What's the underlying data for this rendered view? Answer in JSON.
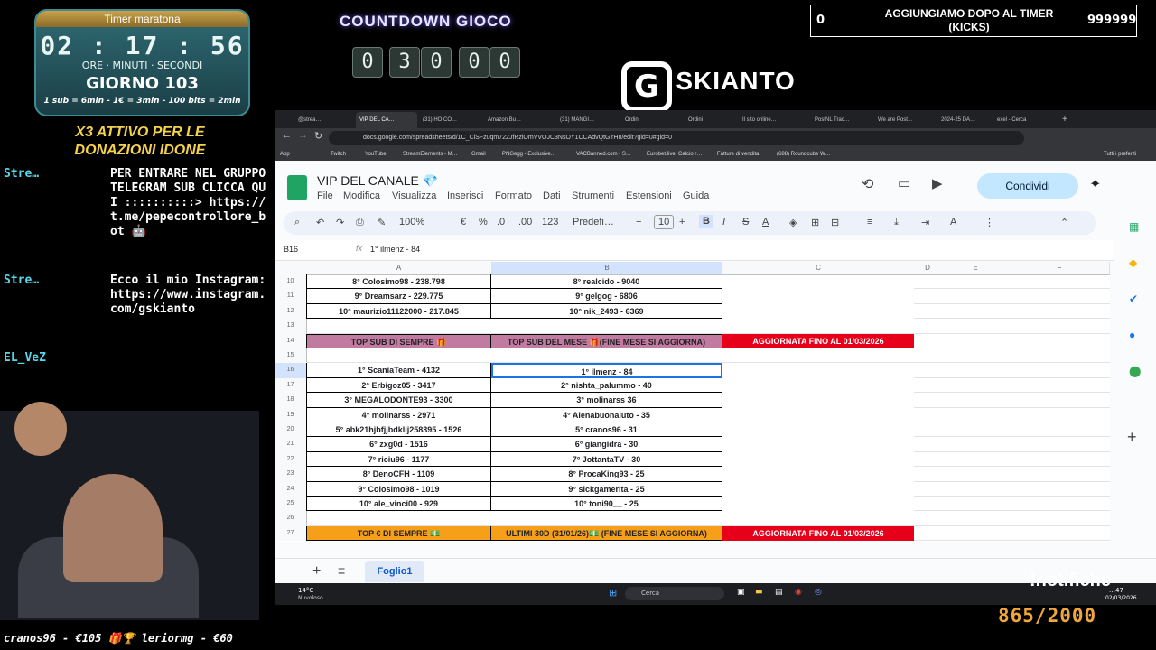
{
  "overlay": {
    "timer": {
      "title": "Timer maratona",
      "digits": "02 : 17 : 56",
      "units": "ORE · MINUTI · SECONDI",
      "day": "GIORNO 103",
      "rules": "1 sub = 6min - 1€ = 3min - 100 bits = 2min"
    },
    "promo": "X3 ATTIVO PER LE DONAZIONI IDONE",
    "chat": [
      {
        "user": "Stre…",
        "text": "PER ENTRARE NEL GRUPPO TELEGRAM SUB CLICCA QUI ::::::::::> https://t.me/pepecontrollore_bot 🤖"
      },
      {
        "user": "Stre…",
        "text": "Ecco il mio Instagram: https://www.instagram.com/gskianto"
      },
      {
        "user": "EL_VeZ",
        "text": ""
      }
    ],
    "countdown": {
      "title": "COUNTDOWN GIOCO",
      "digits": [
        "0",
        "3",
        "0",
        "0",
        "0"
      ]
    },
    "logo": {
      "letter": "G",
      "text": "·SKIANTO"
    },
    "kicks": {
      "left": "0",
      "label": "AGGIUNGIAMO DOPO AL TIMER (KICKS)",
      "right": "999999"
    },
    "donations": "cranos96 - €105   🎁🏆 leriormg - €60",
    "notifications": "!notifiche",
    "progress": "865/2000"
  },
  "browser": {
    "tabs": [
      "@strea…",
      "VIP DEL CA…",
      "(31) HO CO…",
      "Amazon Bu…",
      "(31) MANGI…",
      "Ordini",
      "Ordini",
      "Il sito online…",
      "PostNL Trac…",
      "We are Post…",
      "2024-25 DA…",
      "exel - Cerca"
    ],
    "url": "docs.google.com/spreadsheets/d/1C_ClSFz0qm722JfRzlOmVVOJC3NsOY1CCAdvQtGlrH8/edit?gid=0#gid=0",
    "bookmarks": [
      "App",
      "Twitch",
      "YouTube",
      "StreamElements - M…",
      "Gmail",
      "PNGegg - Exclusive…",
      "VACBanned.com - S…",
      "Eurobet.live: Calcio r…",
      "Fatture di vendita",
      "(688) Roundcube W…",
      "Tutti i preferiti"
    ]
  },
  "sheets": {
    "title": "VIP DEL CANALE 💎",
    "menu": [
      "File",
      "Modifica",
      "Visualizza",
      "Inserisci",
      "Formato",
      "Dati",
      "Strumenti",
      "Estensioni",
      "Guida"
    ],
    "share": "Condividi",
    "toolbar": {
      "zoom": "100%",
      "currency": "€",
      "percent": "%",
      "dec_less": ".0",
      "dec_more": ".00",
      "numfmt": "123",
      "font": "Predefi…",
      "size": "10"
    },
    "cell_ref": "B16",
    "formula": "1° ilmenz - 84",
    "columns": [
      "A",
      "B",
      "C",
      "D",
      "E",
      "F"
    ],
    "rows": [
      {
        "n": "10",
        "a": "8° Colosimo98 - 238.798",
        "b": "8° realcido - 9040",
        "c": "",
        "style": "data"
      },
      {
        "n": "11",
        "a": "9° Dreamsarz - 229.775",
        "b": "9° gelgog - 6806",
        "c": "",
        "style": "data"
      },
      {
        "n": "12",
        "a": "10° maurizio11122000 - 217.845",
        "b": "10° nik_2493 - 6369",
        "c": "",
        "style": "data"
      },
      {
        "n": "13",
        "a": "",
        "b": "",
        "c": "",
        "style": "empty"
      },
      {
        "n": "14",
        "a": "TOP SUB DI SEMPRE 🎁",
        "b": "TOP SUB DEL MESE 🎁(FINE MESE SI AGGIORNA)",
        "c": "AGGIORNATA FINO AL  01/03/2026",
        "style": "pink"
      },
      {
        "n": "15",
        "a": "",
        "b": "",
        "c": "",
        "style": "empty"
      },
      {
        "n": "16",
        "a": "1° ScaniaTeam - 4132",
        "b": "1° ilmenz - 84",
        "c": "",
        "style": "data"
      },
      {
        "n": "17",
        "a": "2° Erbigoz05 - 3417",
        "b": "2° nishta_palummo - 40",
        "c": "",
        "style": "data"
      },
      {
        "n": "18",
        "a": "3° MEGALODONTE93 - 3300",
        "b": "3° molinarss 36",
        "c": "",
        "style": "data"
      },
      {
        "n": "19",
        "a": "4° molinarss - 2971",
        "b": "4° Alenabuonaiuto - 35",
        "c": "",
        "style": "data"
      },
      {
        "n": "20",
        "a": "5° abk21hjbfjjbdklij258395 - 1526",
        "b": "5° cranos96 - 31",
        "c": "",
        "style": "data"
      },
      {
        "n": "21",
        "a": "6° zxg0d - 1516",
        "b": "6° giangidra - 30",
        "c": "",
        "style": "data"
      },
      {
        "n": "22",
        "a": "7° riciu96 - 1177",
        "b": "7° JottantaTV - 30",
        "c": "",
        "style": "data"
      },
      {
        "n": "23",
        "a": "8° DenoCFH - 1109",
        "b": "8° ProcaKing93 - 25",
        "c": "",
        "style": "data"
      },
      {
        "n": "24",
        "a": "9° Colosimo98 - 1019",
        "b": "9° sickgamerita - 25",
        "c": "",
        "style": "data"
      },
      {
        "n": "25",
        "a": "10° ale_vinci00 - 929",
        "b": "10° toni90__ -  25",
        "c": "",
        "style": "data"
      },
      {
        "n": "26",
        "a": "",
        "b": "",
        "c": "",
        "style": "empty"
      },
      {
        "n": "27",
        "a": "TOP € DI SEMPRE 💵",
        "b": "ULTIMI 30D (31/01/26)💵 (FINE MESE SI AGGIORNA)",
        "c": "AGGIORNATA FINO AL  01/03/2026",
        "style": "orange"
      }
    ],
    "sheet_tab": "Foglio1",
    "weather": {
      "temp": "14°C",
      "desc": "Nuvoloso"
    },
    "search": "Cerca",
    "clock": {
      "time": "…47",
      "date": "02/03/2026"
    }
  }
}
